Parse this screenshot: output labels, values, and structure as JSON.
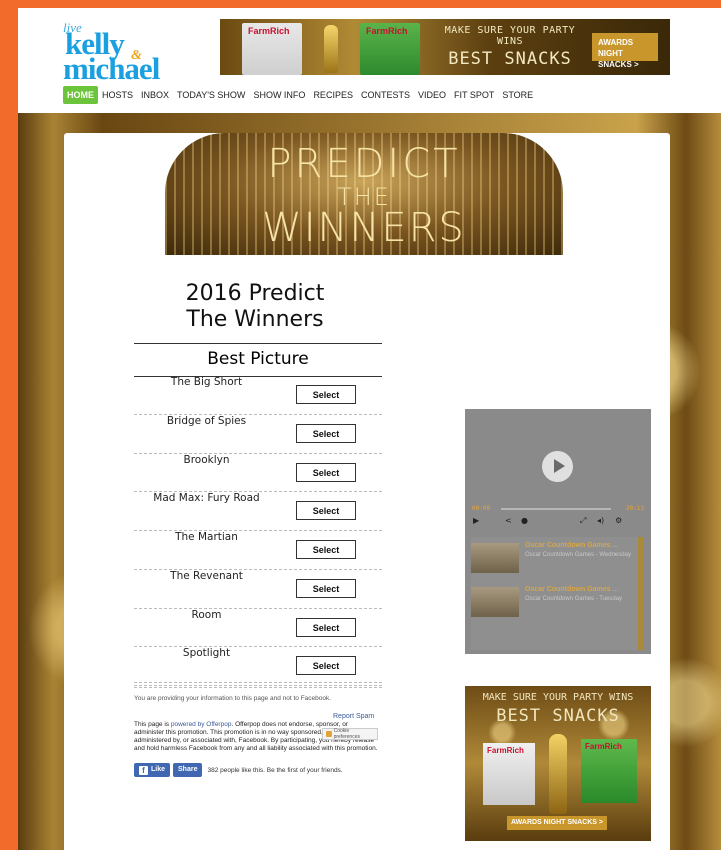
{
  "brand": {
    "live": "live",
    "kelly": "kelly",
    "amp": "&",
    "michael": "michael",
    "color": "#1aa0e0"
  },
  "top_ad": {
    "pkg1": "FarmRich",
    "pkg2": "FarmRich",
    "line1": "MAKE SURE YOUR PARTY WINS",
    "line2": "BEST SNACKS",
    "cta": "AWARDS NIGHT SNACKS >"
  },
  "nav": [
    {
      "label": "HOME",
      "active": true
    },
    {
      "label": "HOSTS"
    },
    {
      "label": "INBOX"
    },
    {
      "label": "TODAY'S SHOW"
    },
    {
      "label": "SHOW INFO"
    },
    {
      "label": "RECIPES"
    },
    {
      "label": "CONTESTS"
    },
    {
      "label": "VIDEO"
    },
    {
      "label": "FIT SPOT"
    },
    {
      "label": "STORE"
    }
  ],
  "banner": {
    "l1": "PREDICT",
    "l2": "THE",
    "l3": "WINNERS"
  },
  "contest": {
    "title": "2016 Predict The Winners",
    "category": "Best Picture",
    "select_label": "Select",
    "nominees": [
      "The Big Short",
      "Bridge of Spies",
      "Brooklyn",
      "Mad Max: Fury Road",
      "The Martian",
      "The Revenant",
      "Room",
      "Spotlight"
    ]
  },
  "footer": {
    "disclaimer": "You are providing your information to this page and not to Facebook.",
    "report_spam": "Report Spam",
    "fine_pre": "This page is ",
    "fine_link": "powered by Offerpop",
    "fine_post": ". Offerpop does not endorse, sponsor, or administer this promotion. This promotion is in no way sponsored, endorsed or administered by, or associated with, Facebook. By participating, you hereby release and hold harmless Facebook from any and all liability associated with this promotion.",
    "cookie": "Cookie preferences",
    "like": "Like",
    "share": "Share",
    "like_count": "382 people like this. Be the first of your friends."
  },
  "video": {
    "time_left": "00:00",
    "time_right": "20:13",
    "items": [
      {
        "title": "Oscar Countdown Games ...",
        "sub": "Oscar Countdown Games - Wednesday"
      },
      {
        "title": "Oscar Countdown Games ...",
        "sub": "Oscar Countdown Games - Tuesday"
      }
    ]
  },
  "side_ad": {
    "line1": "MAKE SURE YOUR PARTY WINS",
    "line2": "BEST SNACKS",
    "pkg1": "FarmRich",
    "pkg2": "FarmRich",
    "cta": "AWARDS NIGHT SNACKS >"
  }
}
